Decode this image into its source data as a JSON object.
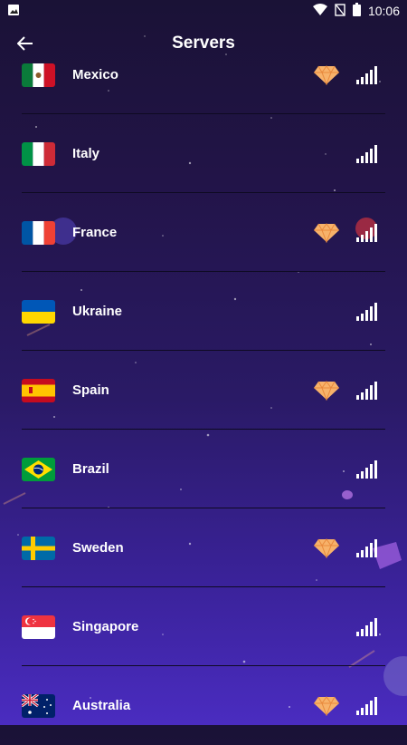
{
  "status_bar": {
    "time": "10:06",
    "icons": [
      "image-icon",
      "wifi-icon",
      "sim-icon",
      "battery-icon"
    ]
  },
  "header": {
    "title": "Servers",
    "back_icon": "arrow-left-icon"
  },
  "servers": [
    {
      "name": "Mexico",
      "premium": true
    },
    {
      "name": "Italy",
      "premium": false
    },
    {
      "name": "France",
      "premium": true
    },
    {
      "name": "Ukraine",
      "premium": false
    },
    {
      "name": "Spain",
      "premium": true
    },
    {
      "name": "Brazil",
      "premium": false
    },
    {
      "name": "Sweden",
      "premium": true
    },
    {
      "name": "Singapore",
      "premium": false
    },
    {
      "name": "Australia",
      "premium": true
    }
  ],
  "colors": {
    "premium_gem": "#f7b26a",
    "background_top": "#1a1236",
    "background_bottom": "#4a2cc0"
  }
}
